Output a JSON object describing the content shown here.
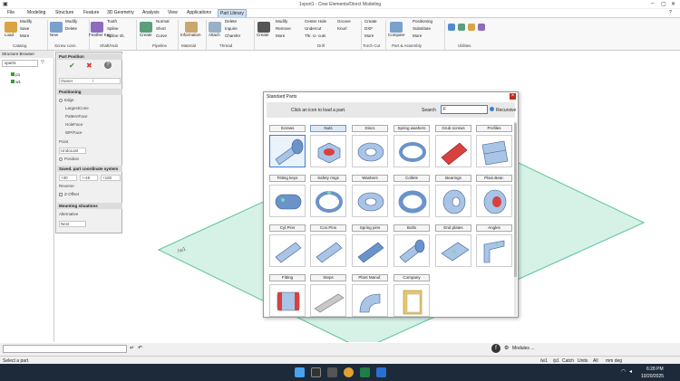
{
  "window": {
    "title": "1vport1 - Cree Elements/Direct Modeling"
  },
  "tabs": [
    "File",
    "Modeling",
    "Structure",
    "Feature",
    "3D Geometry",
    "Analysis",
    "View",
    "Applications",
    "Part Library"
  ],
  "active_tab": "Part Library",
  "ribbon": {
    "load": "Load",
    "modify": "Modify",
    "save": "Save",
    "more": "More",
    "new": "New",
    "modify2": "Modify",
    "delete": "Delete",
    "feather_key": "Feather Key",
    "tooth": "Tooth",
    "spline": "Spline",
    "spline_sh": "Spline sh.",
    "create": "Create",
    "normal": "Normal",
    "short": "Short",
    "curve": "Curve",
    "information": "Information",
    "attach": "Attach",
    "delete2": "Delete",
    "inquire": "Inquire",
    "chamfer": "Chamfer",
    "create2": "Create",
    "modify3": "Modify",
    "remove": "Remove",
    "more2": "More",
    "center_hole": "Center Hole",
    "undercut": "Undercut",
    "thr_u_cuts": "Thr. U- cuts",
    "groove": "Groove",
    "knurl": "Knurl",
    "create3": "Create",
    "dxf": "DXF",
    "more3": "More",
    "compare": "Compare",
    "positioning": "Positioning",
    "substitute": "Substitute",
    "more4": "More",
    "groups": [
      "Catalog",
      "Screw conn.",
      "Shaft/Hub",
      "Pipeline",
      "Material",
      "Thread",
      "Drill",
      "Torch Cut",
      "Part & Assembly",
      "Utilities"
    ]
  },
  "structure_browser": {
    "title": "Structure Browser",
    "vport": "vport1",
    "items": [
      "p1",
      "w1"
    ]
  },
  "part_position": {
    "title": "Part Position",
    "owner_label": "Owner",
    "owner_value": "/",
    "positioning_header": "Positioning",
    "options": [
      "Edge",
      "LargestCone",
      "PatternFace",
      "HoleFace",
      "WP/Face"
    ],
    "point_label": "Point",
    "undo_last": "UndoLast",
    "position": "Position",
    "coord_header": "Saved. part coordinate system",
    "coords": [
      "+30",
      "+-45",
      "+180"
    ],
    "reverse": "Reverse",
    "z_offset": "Z-Offset",
    "mounting_header": "Mounting situations",
    "alternative": "Alternative",
    "next": "Next"
  },
  "workplane_label": "/w1",
  "dialog": {
    "title": "Standard Parts",
    "hint": "Click an icon to load a part.",
    "search_label": "Search",
    "search_placeholder": "F",
    "recursive": "Recursive",
    "rows": [
      [
        "Screws",
        "Nuts",
        "Discs",
        "Spring washers",
        "Grub screws",
        "Profiles"
      ],
      [
        "Fitting keys",
        "Safety rings",
        "Washers",
        "Collets",
        "Bearings",
        "Plain.Bear."
      ],
      [
        "Cyl.Pins",
        "Con.Pins",
        "Spring pins",
        "Bolts",
        "End plates",
        "Angles"
      ],
      [
        "Fitting",
        "Steps",
        "Plant Manuf.",
        "Company"
      ]
    ]
  },
  "status": {
    "prompt": "Select a part.",
    "modules": "Modules ...",
    "items": [
      "/w1",
      "/p1",
      "Catch",
      "Units",
      "All"
    ],
    "units": "mm deg"
  },
  "taskbar": {
    "time": "6:28 PM",
    "date": "10/20/2025"
  },
  "colors": {
    "accent": "#3b7fd4",
    "ribbon_tab": "#cfe0f3",
    "plane": "#cfeee2",
    "plane_edge": "#6bc9a3",
    "part_blue": "#6a93c9",
    "part_red": "#d94040"
  }
}
